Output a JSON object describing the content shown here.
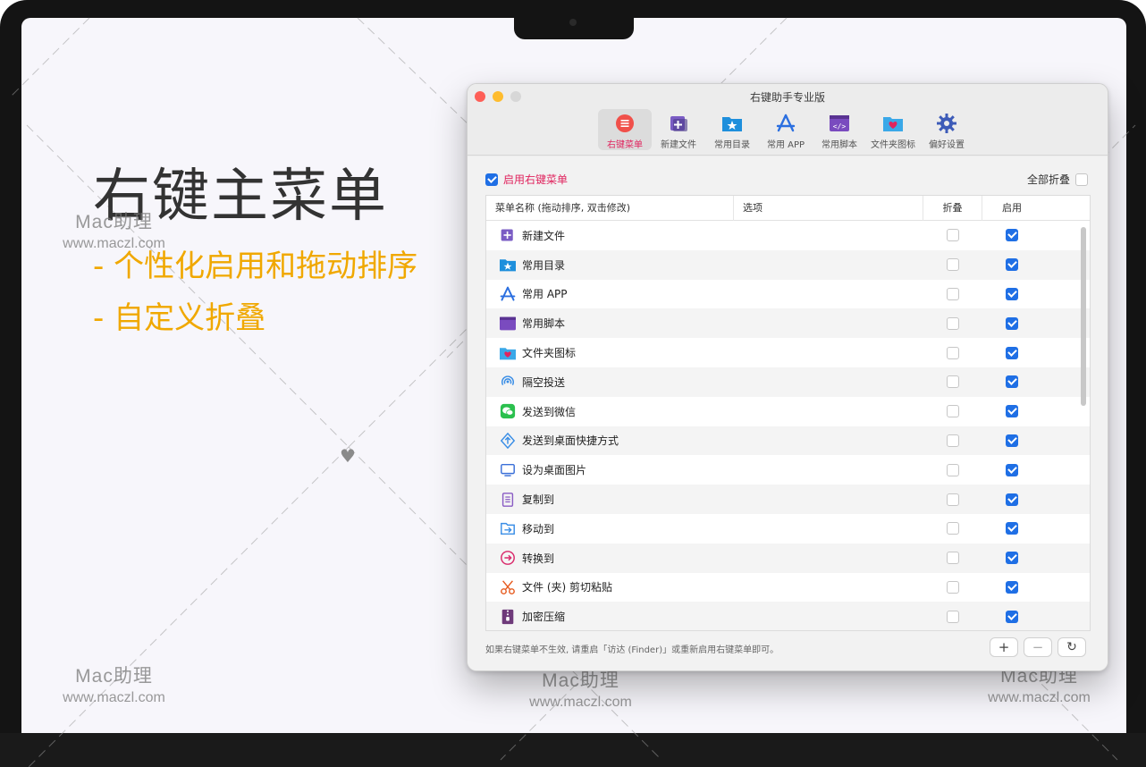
{
  "promo": {
    "title": "右键主菜单",
    "line1": "- 个性化启用和拖动排序",
    "line2": "- 自定义折叠"
  },
  "watermark": {
    "name": "Mac助理",
    "url": "www.maczl.com"
  },
  "window": {
    "title": "右键助手专业版",
    "toolbar": [
      {
        "label": "右键菜单",
        "icon": "menu-icon",
        "active": true
      },
      {
        "label": "新建文件",
        "icon": "new-file-icon"
      },
      {
        "label": "常用目录",
        "icon": "folder-star-icon"
      },
      {
        "label": "常用 APP",
        "icon": "app-store-icon"
      },
      {
        "label": "常用脚本",
        "icon": "script-icon"
      },
      {
        "label": "文件夹图标",
        "icon": "folder-heart-icon"
      },
      {
        "label": "偏好设置",
        "icon": "gear-icon"
      }
    ],
    "enable_label": "启用右键菜单",
    "fold_all_label": "全部折叠",
    "columns": {
      "name": "菜单名称 (拖动排序, 双击修改)",
      "option": "选项",
      "fold": "折叠",
      "enable": "启用"
    },
    "rows": [
      {
        "name": "新建文件",
        "icon": "new-file-icon"
      },
      {
        "name": "常用目录",
        "icon": "folder-star-icon"
      },
      {
        "name": "常用 APP",
        "icon": "app-store-icon"
      },
      {
        "name": "常用脚本",
        "icon": "script-icon"
      },
      {
        "name": "文件夹图标",
        "icon": "folder-heart-icon"
      },
      {
        "name": "隔空投送",
        "icon": "airdrop-icon"
      },
      {
        "name": "发送到微信",
        "icon": "wechat-icon"
      },
      {
        "name": "发送到桌面快捷方式",
        "icon": "shortcut-icon"
      },
      {
        "name": "设为桌面图片",
        "icon": "desktop-icon"
      },
      {
        "name": "复制到",
        "icon": "copy-icon"
      },
      {
        "name": "移动到",
        "icon": "move-icon"
      },
      {
        "name": "转换到",
        "icon": "convert-icon"
      },
      {
        "name": "文件 (夹) 剪切粘贴",
        "icon": "scissors-icon"
      },
      {
        "name": "加密压缩",
        "icon": "zip-icon"
      }
    ],
    "footer_text": "如果右键菜单不生效, 请重启「访达 (Finder)」或重新启用右键菜单即可。",
    "buttons": {
      "add": "+",
      "remove": "−",
      "refresh": "↻"
    }
  }
}
